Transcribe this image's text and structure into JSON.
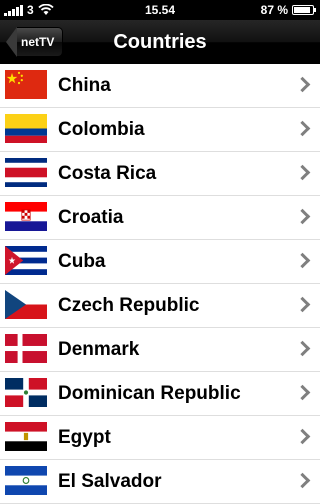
{
  "status_bar": {
    "carrier": "3",
    "time": "15.54",
    "battery": "87 %",
    "battery_level": 0.87
  },
  "nav": {
    "back_label": "netTV",
    "title": "Countries"
  },
  "countries": [
    {
      "name": "China",
      "flag_icon": "china-flag-icon"
    },
    {
      "name": "Colombia",
      "flag_icon": "colombia-flag-icon"
    },
    {
      "name": "Costa Rica",
      "flag_icon": "costa-rica-flag-icon"
    },
    {
      "name": "Croatia",
      "flag_icon": "croatia-flag-icon"
    },
    {
      "name": "Cuba",
      "flag_icon": "cuba-flag-icon"
    },
    {
      "name": "Czech Republic",
      "flag_icon": "czech-republic-flag-icon"
    },
    {
      "name": "Denmark",
      "flag_icon": "denmark-flag-icon"
    },
    {
      "name": "Dominican Republic",
      "flag_icon": "dominican-republic-flag-icon"
    },
    {
      "name": "Egypt",
      "flag_icon": "egypt-flag-icon"
    },
    {
      "name": "El Salvador",
      "flag_icon": "el-salvador-flag-icon"
    }
  ],
  "colors": {
    "nav_background": "#000000",
    "row_divider": "#dedede",
    "chevron": "#7f7f7f"
  }
}
